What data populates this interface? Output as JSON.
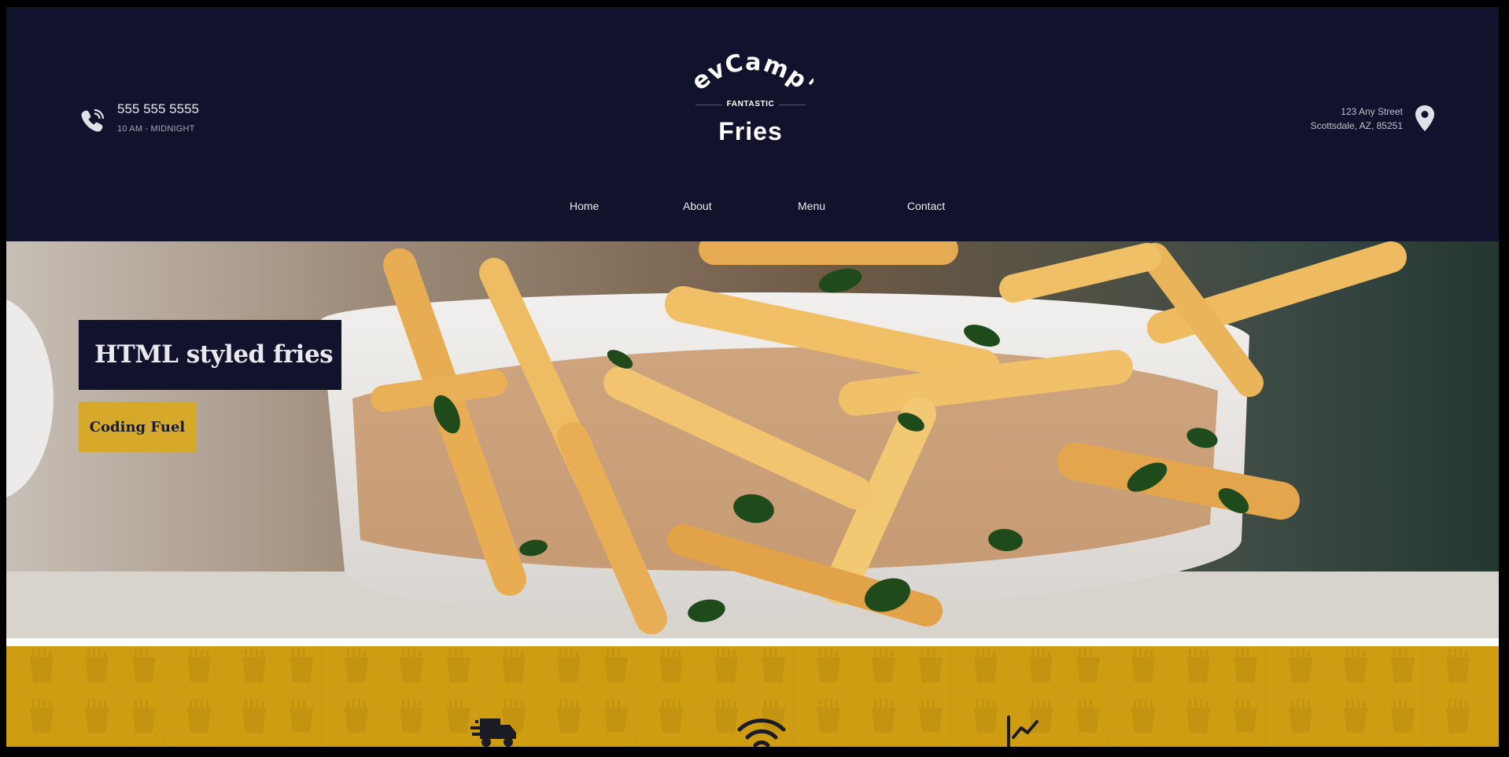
{
  "header": {
    "phone_number": "555 555 5555",
    "hours": "10 AM - MIDNIGHT",
    "address_line1": "123 Any Street",
    "address_line2": "Scottsdale, AZ, 85251"
  },
  "logo": {
    "brand": "DevCamp's",
    "tagline": "FANTASTIC",
    "product": "Fries"
  },
  "nav": {
    "items": [
      "Home",
      "About",
      "Menu",
      "Contact"
    ]
  },
  "hero": {
    "title": "HTML styled fries",
    "button_label": "Coding Fuel"
  },
  "features": {
    "icons": [
      "delivery-truck-icon",
      "wifi-icon",
      "line-chart-icon"
    ]
  },
  "colors": {
    "header_bg": "#11122b",
    "accent_gold": "#d7a92b",
    "band_gold": "#cf9d12",
    "text_light": "#e6e6ea"
  }
}
